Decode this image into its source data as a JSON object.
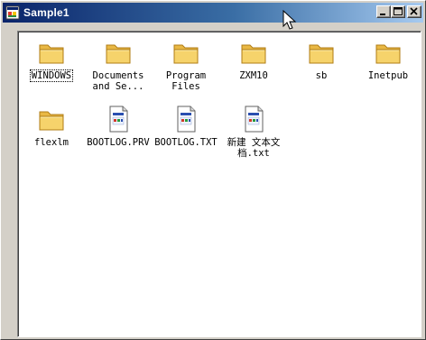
{
  "window": {
    "title": "Sample1",
    "controls": {
      "minimize_icon": "minimize-icon",
      "maximize_icon": "maximize-icon",
      "close_icon": "close-icon"
    }
  },
  "files": [
    {
      "label": "WINDOWS",
      "type": "folder",
      "focused": true
    },
    {
      "label": "Documents\nand Se...",
      "type": "folder"
    },
    {
      "label": "Program\nFiles",
      "type": "folder"
    },
    {
      "label": "ZXM10",
      "type": "folder"
    },
    {
      "label": "sb",
      "type": "folder"
    },
    {
      "label": "Inetpub",
      "type": "folder"
    },
    {
      "label": "flexlm",
      "type": "folder"
    },
    {
      "label": "BOOTLOG.PRV",
      "type": "text-file"
    },
    {
      "label": "BOOTLOG.TXT",
      "type": "text-file"
    },
    {
      "label": "新建 文本文\n档.txt",
      "type": "text-file"
    }
  ],
  "colors": {
    "titlebar_start": "#0a246a",
    "titlebar_end": "#a6caf0",
    "folder_fill": "#f6d36b",
    "window_face": "#d4d0c8"
  }
}
